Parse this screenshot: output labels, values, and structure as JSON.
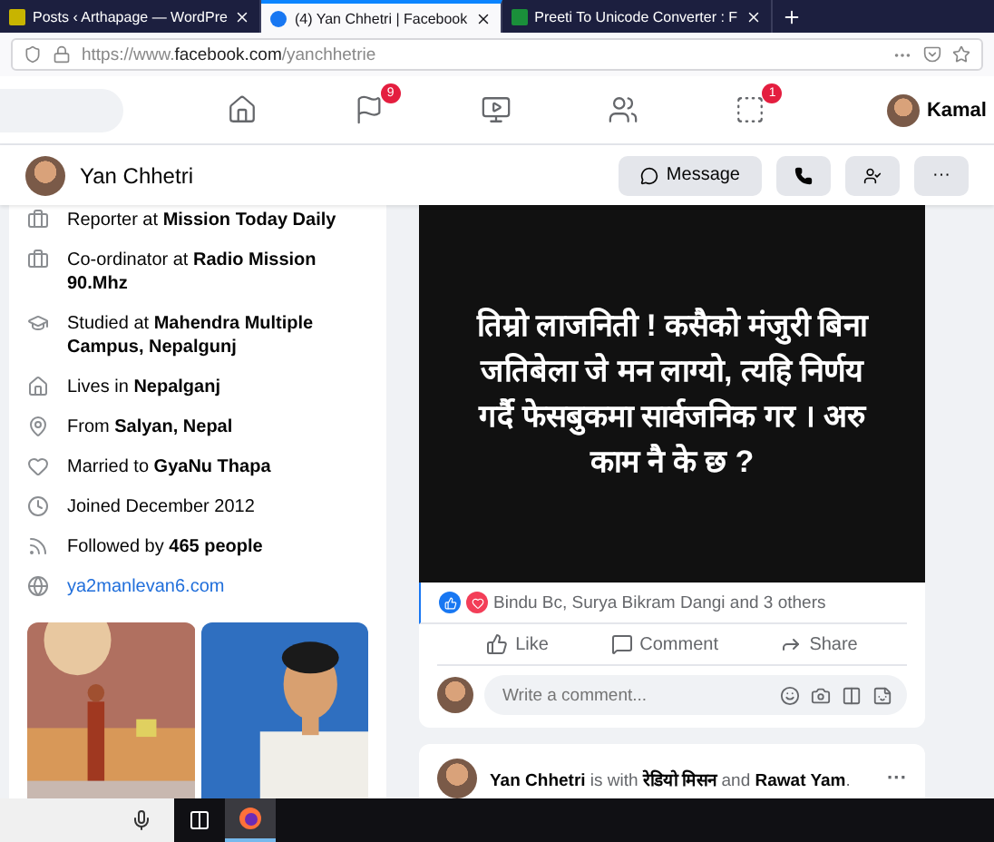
{
  "browser_tabs": [
    {
      "title": "Posts ‹ Arthapage — WordPre",
      "selected": false
    },
    {
      "title": "(4) Yan Chhetri | Facebook",
      "selected": true
    },
    {
      "title": "Preeti To Unicode Converter : F",
      "selected": false
    }
  ],
  "address_bar": {
    "url_prefix": "https://www.",
    "url_domain": "facebook.com",
    "url_path": "/yanchhetrie"
  },
  "nav": {
    "items": [
      {
        "kind": "home",
        "selected": false
      },
      {
        "kind": "pages",
        "badge": "9",
        "selected": false
      },
      {
        "kind": "watch",
        "selected": false
      },
      {
        "kind": "groups",
        "selected": false
      },
      {
        "kind": "gaming",
        "badge": "1",
        "selected": false
      }
    ],
    "user": "Kamal"
  },
  "profile_header": {
    "name": "Yan Chhetri",
    "buttons": [
      {
        "kind": "message",
        "label": "Message"
      },
      {
        "kind": "call"
      },
      {
        "kind": "friends"
      },
      {
        "kind": "more",
        "label": "···"
      }
    ]
  },
  "intro": [
    {
      "kind": "work",
      "text": "Reporter at **Mission Today Daily**"
    },
    {
      "kind": "work",
      "text": "Co-ordinator at **Radio Mission 90.Mhz**"
    },
    {
      "kind": "study",
      "text": "Studied at **Mahendra Multiple Campus, Nepalgunj**"
    },
    {
      "kind": "home",
      "text": "Lives in **Nepalganj**"
    },
    {
      "kind": "place",
      "text": "From **Salyan, Nepal**"
    },
    {
      "kind": "heart",
      "text": "Married to **GyaNu Thapa**"
    },
    {
      "kind": "clock",
      "text": "Joined December 2012"
    },
    {
      "kind": "followers",
      "text": "Followed by **465 people**"
    },
    {
      "kind": "link",
      "text": "ya2manlevan6.com"
    }
  ],
  "post": {
    "image_text": "तिम्रो लाजनिती ! कसैको मंजुरी बिना जतिबेला जे मन लाग्यो, त्यहि निर्णय गर्दै फेसबुकमा सार्वजनिक गर । अरु काम नै के छ ?",
    "reactions": "Bindu Bc, Surya Bikram Dangi and 3 others",
    "actions": [
      {
        "kind": "like",
        "label": "Like"
      },
      {
        "kind": "comment",
        "label": "Comment"
      },
      {
        "kind": "share",
        "label": "Share"
      }
    ],
    "comment_placeholder": "Write a comment..."
  },
  "next_post": {
    "header": "**Yan Chhetri** is with **रेडियो मिसन** and **Rawat Yam**.",
    "menu": "···"
  }
}
